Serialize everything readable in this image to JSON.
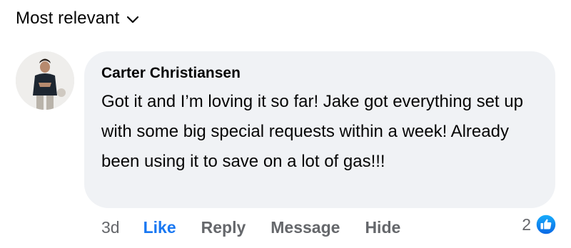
{
  "sort": {
    "label": "Most relevant",
    "chevron_icon": "chevron-down-icon"
  },
  "comment": {
    "author": "Carter Christiansen",
    "text": "Got it and I’m loving it so far! Jake got everything set up with some big special requests within a week! Already been using it to save on a lot of gas!!!",
    "timestamp": "3d",
    "actions": {
      "like": "Like",
      "reply": "Reply",
      "message": "Message",
      "hide": "Hide"
    },
    "reactions": {
      "count": "2",
      "icon": "thumbs-up-icon"
    }
  },
  "colors": {
    "bubble_bg": "#f0f2f5",
    "secondary_text": "#65676b",
    "like_blue": "#1877f2"
  }
}
